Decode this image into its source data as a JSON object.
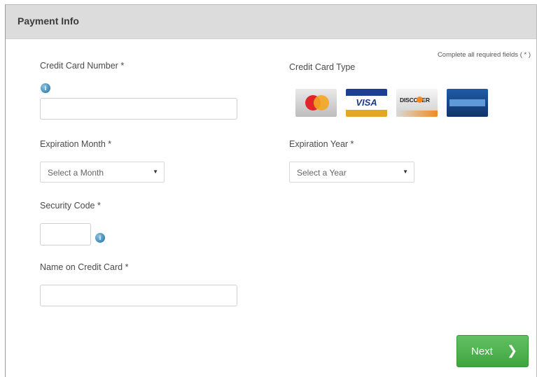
{
  "header": {
    "title": "Payment Info"
  },
  "required_note": "Complete all required fields ( * )",
  "fields": {
    "card_number": {
      "label": "Credit Card Number *",
      "value": ""
    },
    "card_type": {
      "label": "Credit Card Type",
      "cards": [
        {
          "name": "MasterCard",
          "icon": "mastercard-icon"
        },
        {
          "name": "VISA",
          "icon": "visa-icon"
        },
        {
          "name": "DISCOVER",
          "icon": "discover-icon"
        },
        {
          "name": "American Express",
          "icon": "amex-icon"
        }
      ]
    },
    "exp_month": {
      "label": "Expiration Month *",
      "selected": "Select a Month"
    },
    "exp_year": {
      "label": "Expiration Year *",
      "selected": "Select a Year"
    },
    "security_code": {
      "label": "Security Code *",
      "value": ""
    },
    "name_on_card": {
      "label": "Name on Credit Card *",
      "value": ""
    }
  },
  "icons": {
    "info": "i",
    "dropdown": "▼",
    "next_arrow": "❯"
  },
  "next_button": {
    "label": "Next"
  },
  "colors": {
    "header_bg": "#dcdcdc",
    "next_green": "#4cae4c",
    "info_blue": "#3b88b5"
  }
}
